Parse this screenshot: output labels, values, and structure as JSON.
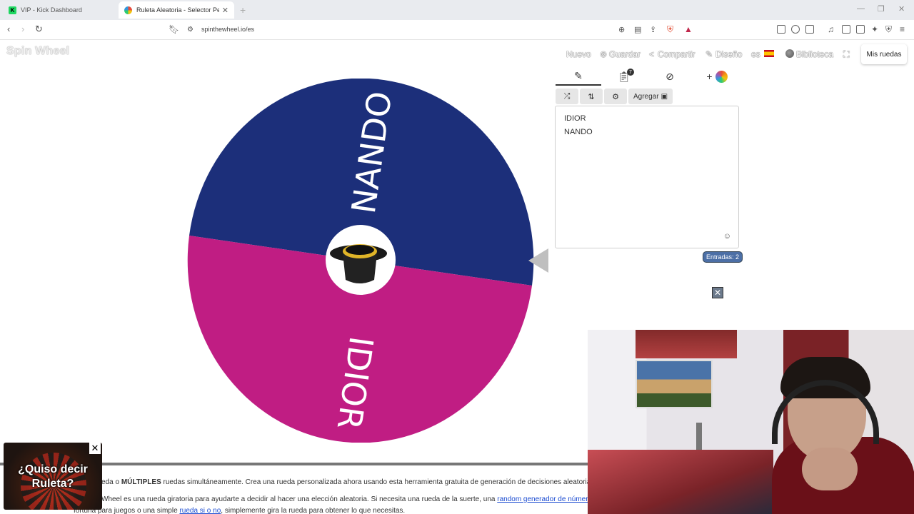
{
  "browser": {
    "tabs": [
      {
        "title": "VIP - Kick Dashboard",
        "active": false,
        "favicon": "kick-icon"
      },
      {
        "title": "Ruleta Aleatoria - Selector Personalizado",
        "active": true,
        "favicon": "wheel-icon"
      }
    ],
    "url": "spinthewheel.io/es"
  },
  "site": {
    "logo": "Spin Wheel",
    "menu": {
      "nuevo": "Nuevo",
      "guardar": "Guardar",
      "compartir": "Compartir",
      "diseno": "Diseño",
      "language": "es",
      "biblioteca": "Biblioteca",
      "my_wheels": "Mis ruedas"
    }
  },
  "editor": {
    "tabs": [
      "edit-icon",
      "clipboard-icon",
      "hide-icon",
      "add-color-icon"
    ],
    "clipboard_badge": "7",
    "tools": {
      "add_image": "Agregar"
    },
    "entries": [
      "IDIOR",
      "NANDO"
    ],
    "entries_count": "Entradas: 2"
  },
  "wheel": {
    "segments": [
      {
        "label": "NANDO",
        "color": "#1c2f7a"
      },
      {
        "label": "IDIOR",
        "color": "#c01d83"
      }
    ],
    "center_icon": "top-hat-icon",
    "pointer_color": "#bfbfbf"
  },
  "article": {
    "line1_pre": "eda o ",
    "line1_bold": "MÚLTIPLES",
    "line1_post": " ruedas simultáneamente. Crea una rueda personalizada ahora usando esta herramienta gratuita de generación de decisiones aleatorias.",
    "line2_pre": "Wheel es una rueda giratoria para ayudarte a decidir al hacer una elección aleatoria. Si necesita una rueda de la suerte, una ",
    "line2_link": "random generador de números",
    "line3_pre": "fortuna para juegos o una simple ",
    "line3_link": "rueda si o no",
    "line3_post": ", simplemente gira la rueda para obtener lo que necesitas."
  },
  "ad": {
    "text_line1": "¿Quiso decir",
    "text_line2": "Ruleta?"
  }
}
